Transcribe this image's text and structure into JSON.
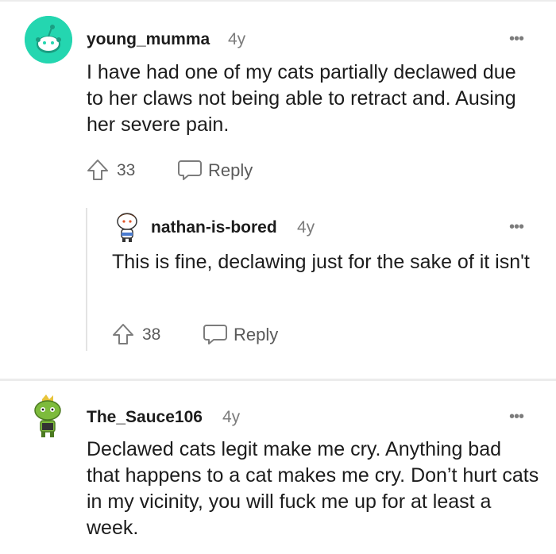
{
  "comments": [
    {
      "username": "young_mumma",
      "age": "4y",
      "more": "•••",
      "body": "I have had one of my cats partially declawed due to her claws not being able to retract and. Ausing her severe pain.",
      "votes": "33",
      "reply_label": "Reply"
    },
    {
      "username": "nathan-is-bored",
      "age": "4y",
      "more": "•••",
      "body": "This is fine, declawing just for the sake of it isn't",
      "votes": "38",
      "reply_label": "Reply"
    },
    {
      "username": "The_Sauce106",
      "age": "4y",
      "more": "•••",
      "body": "Declawed cats legit make me cry. Anything bad that happens to a cat makes me cry. Don’t hurt cats in my vicinity, you will fuck me up for at least a week."
    }
  ],
  "colors": {
    "avatar_teal": "#24d6b0",
    "avatar_green": "#7dbb3c",
    "icon_gray": "#7c7c7c",
    "divider": "#ececec"
  },
  "icons": [
    "upvote-arrow-icon",
    "reply-bubble-icon",
    "more-options-icon"
  ]
}
